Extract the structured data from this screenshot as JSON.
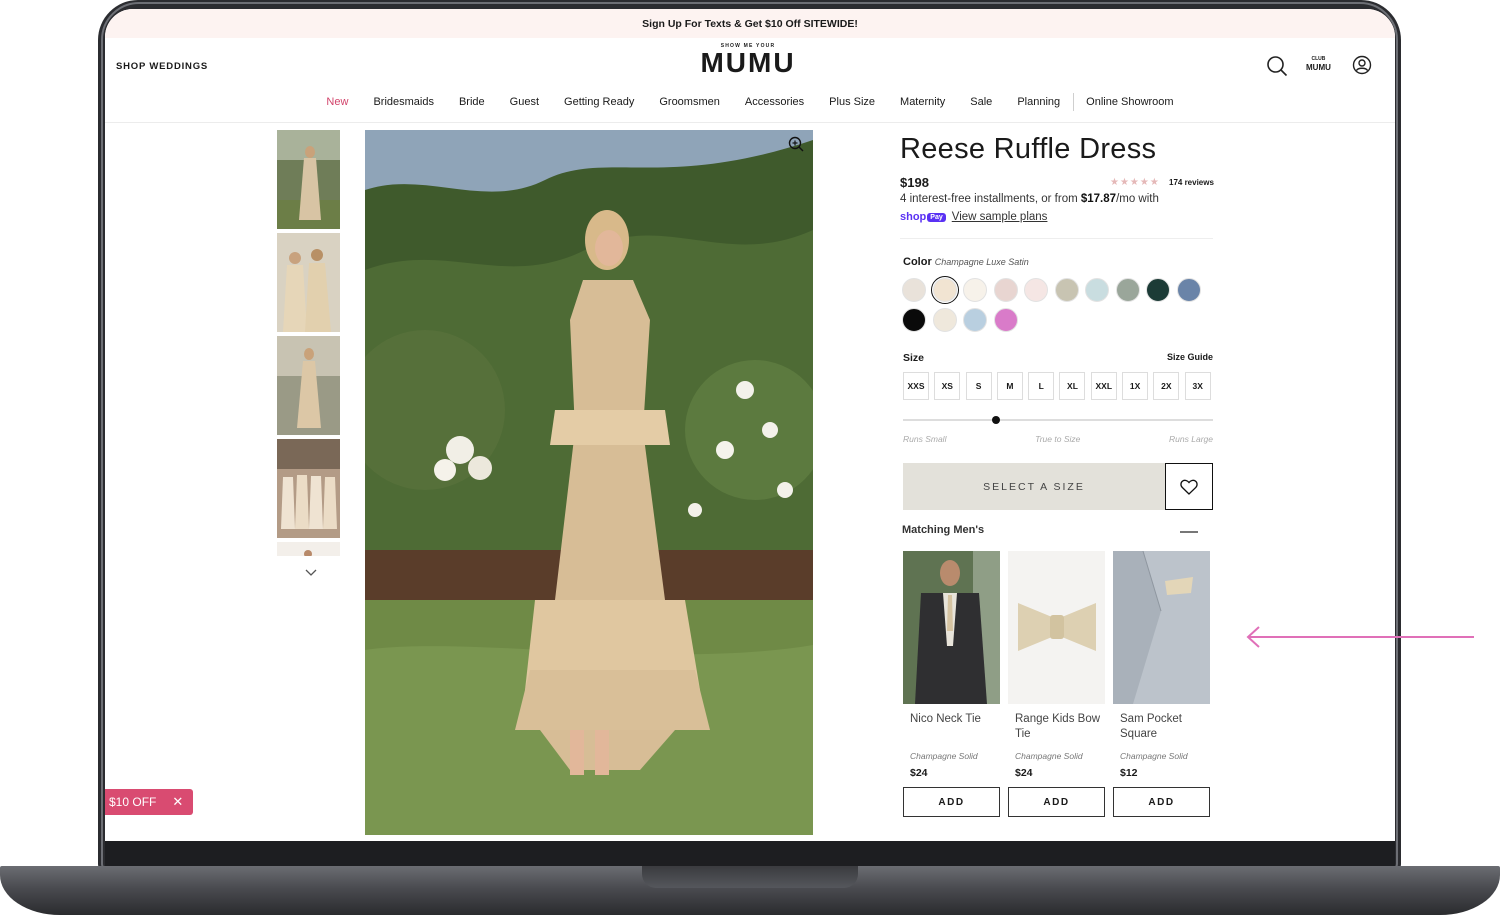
{
  "announcement": "Sign Up For Texts & Get $10 Off SITEWIDE!",
  "header": {
    "shop_weddings": "SHOP WEDDINGS",
    "logo_small": "SHOW ME YOUR",
    "logo_main": "MUMU",
    "club_top": "CLUB",
    "club_bottom": "MUMU",
    "icons": [
      "search-icon",
      "account-icon"
    ]
  },
  "nav": [
    "New",
    "Bridesmaids",
    "Bride",
    "Guest",
    "Getting Ready",
    "Groomsmen",
    "Accessories",
    "Plus Size",
    "Maternity",
    "Sale",
    "Planning",
    "Online Showroom"
  ],
  "product": {
    "title": "Reese Ruffle Dress",
    "price": "$198",
    "stars": "★★★★★",
    "reviews": "174 reviews",
    "installments_prefix": "4 interest-free installments, or from ",
    "installments_amount": "$17.87",
    "installments_suffix": "/mo with",
    "shop_word": "shop",
    "pay_word": "Pay",
    "sample_plans": "View sample plans",
    "color_label": "Color",
    "color_value": "Champagne Luxe Satin",
    "swatches": [
      "#e9e2da",
      "#f1e4d2",
      "#f7f2ea",
      "#e8d5d1",
      "#f5e6e4",
      "#c8c4b2",
      "#c9dde0",
      "#9aa69a",
      "#1c3b36",
      "#6a84a8",
      "#0a0a0a",
      "#efe8dc",
      "#b9cfe0",
      "#d97bc9"
    ],
    "selected_swatch_index": 1,
    "size_label": "Size",
    "size_guide": "Size Guide",
    "sizes": [
      "XXS",
      "XS",
      "S",
      "M",
      "L",
      "XL",
      "XXL",
      "1X",
      "2X",
      "3X"
    ],
    "fit": {
      "small": "Runs Small",
      "true": "True to Size",
      "large": "Runs Large",
      "position": 0.3
    },
    "select_size": "SELECT A SIZE",
    "matching_title": "Matching Men's",
    "matching": [
      {
        "name": "Nico Neck Tie",
        "color": "Champagne Solid",
        "price": "$24",
        "add": "ADD"
      },
      {
        "name": "Range Kids Bow Tie",
        "color": "Champagne Solid",
        "price": "$24",
        "add": "ADD"
      },
      {
        "name": "Sam Pocket Square",
        "color": "Champagne Solid",
        "price": "$12",
        "add": "ADD"
      }
    ]
  },
  "promo_tab": {
    "label": "$10 OFF",
    "close": "✕"
  },
  "colors": {
    "accent_pink": "#d94b71",
    "nav_new": "#d2446b",
    "shoppay": "#5a31f4",
    "button_bg": "#e3e1da",
    "arrow": "#e070b8"
  }
}
